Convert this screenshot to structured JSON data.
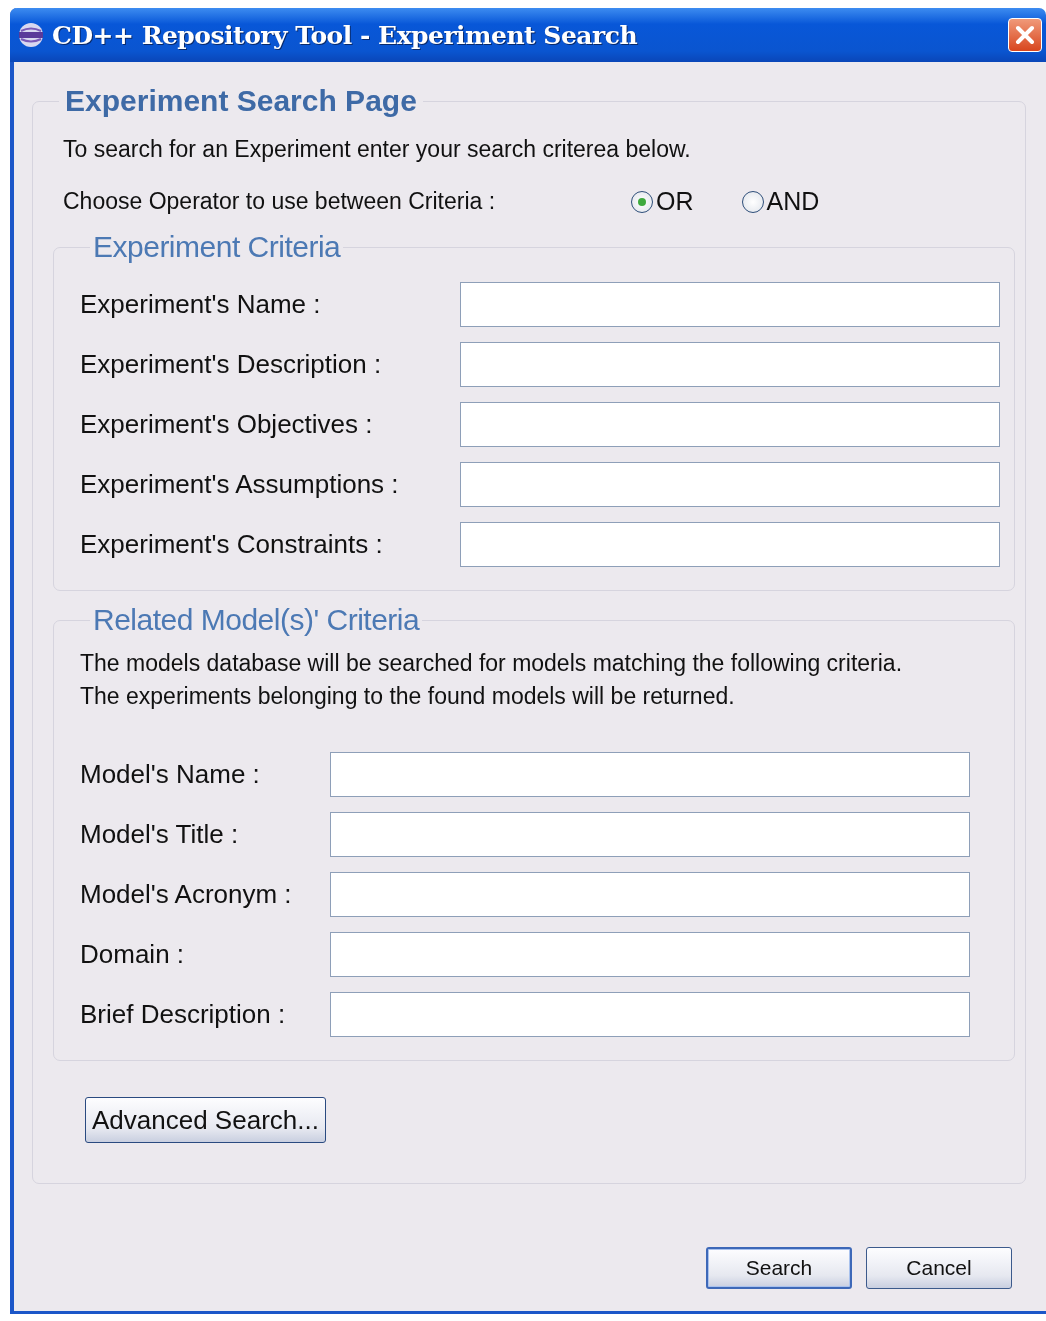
{
  "window": {
    "title": "CD++ Repository Tool - Experiment Search"
  },
  "page": {
    "title": "Experiment Search Page",
    "intro": "To search for an Experiment enter your search criterea below.",
    "operator_label": "Choose Operator to use between Criteria :",
    "operators": [
      {
        "label": "OR",
        "selected": true
      },
      {
        "label": "AND",
        "selected": false
      }
    ]
  },
  "experiment_criteria": {
    "title": "Experiment Criteria",
    "fields": [
      {
        "label": "Experiment's Name :"
      },
      {
        "label": "Experiment's Description :"
      },
      {
        "label": "Experiment's Objectives :"
      },
      {
        "label": "Experiment's Assumptions :"
      },
      {
        "label": "Experiment's Constraints :"
      }
    ]
  },
  "model_criteria": {
    "title": "Related Model(s)' Criteria",
    "description": "The models database will be searched for models matching the following criteria. The experiments belonging to the found models will be returned.",
    "fields": [
      {
        "label": "Model's Name :"
      },
      {
        "label": "Model's Title :"
      },
      {
        "label": "Model's Acronym :"
      },
      {
        "label": "Domain :"
      },
      {
        "label": "Brief Description :"
      }
    ]
  },
  "advanced_button": {
    "label": "Advanced Search..."
  },
  "buttons": [
    {
      "label": "Search",
      "default": true
    },
    {
      "label": "Cancel",
      "default": false
    }
  ]
}
